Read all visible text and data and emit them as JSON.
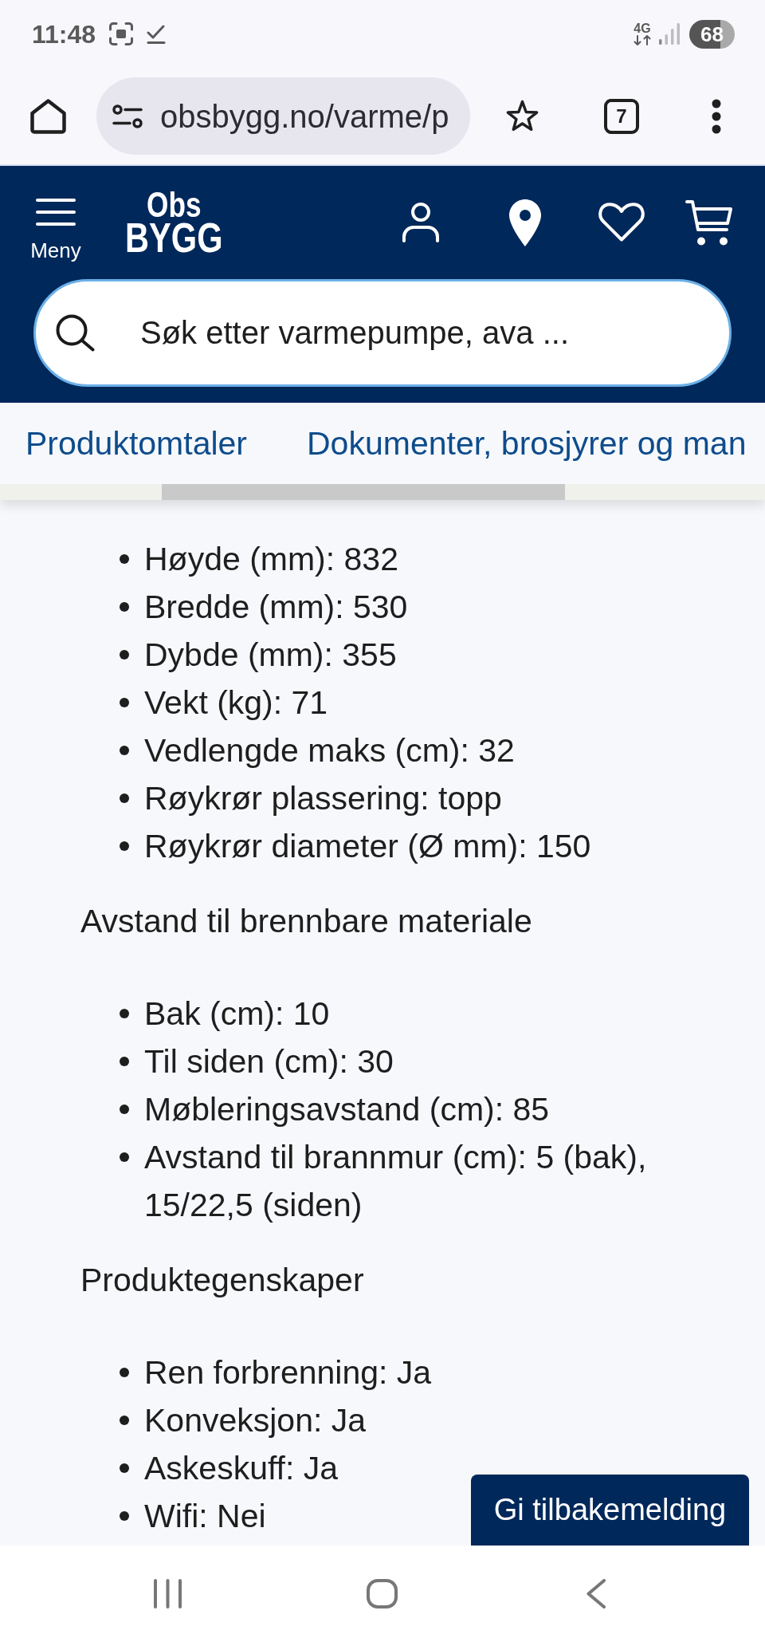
{
  "status_bar": {
    "time": "11:48",
    "network": "4G",
    "battery": "68"
  },
  "browser": {
    "url": "obsbygg.no/varme/p",
    "tab_count": "7"
  },
  "header": {
    "menu_label": "Meny",
    "logo": [
      "Obs",
      "BYGG"
    ]
  },
  "search": {
    "placeholder": "Søk etter varmepumpe, ava ..."
  },
  "section_links": [
    {
      "label": "Produktomtaler"
    },
    {
      "label": "Dokumenter, brosjyrer og man"
    }
  ],
  "specs": [
    {
      "items": [
        "Høyde (mm): 832",
        "Bredde (mm): 530",
        "Dybde (mm): 355",
        "Vekt (kg): 71",
        "Vedlengde maks (cm): 32",
        "Røykrør plassering: topp",
        "Røykrør diameter (Ø mm): 150"
      ]
    },
    {
      "heading": "Avstand til brennbare materiale",
      "items": [
        "Bak (cm): 10",
        "Til siden (cm): 30",
        "Møbleringsavstand (cm): 85",
        "Avstand til brannmur (cm): 5 (bak), 15/22,5 (siden)"
      ]
    },
    {
      "heading": "Produktegenskaper",
      "items": [
        "Ren forbrenning: Ja",
        "Konveksjon: Ja",
        "Askeskuff: Ja",
        "Wifi: Nei"
      ]
    }
  ],
  "feedback_button": {
    "label": "Gi tilbakemelding"
  }
}
